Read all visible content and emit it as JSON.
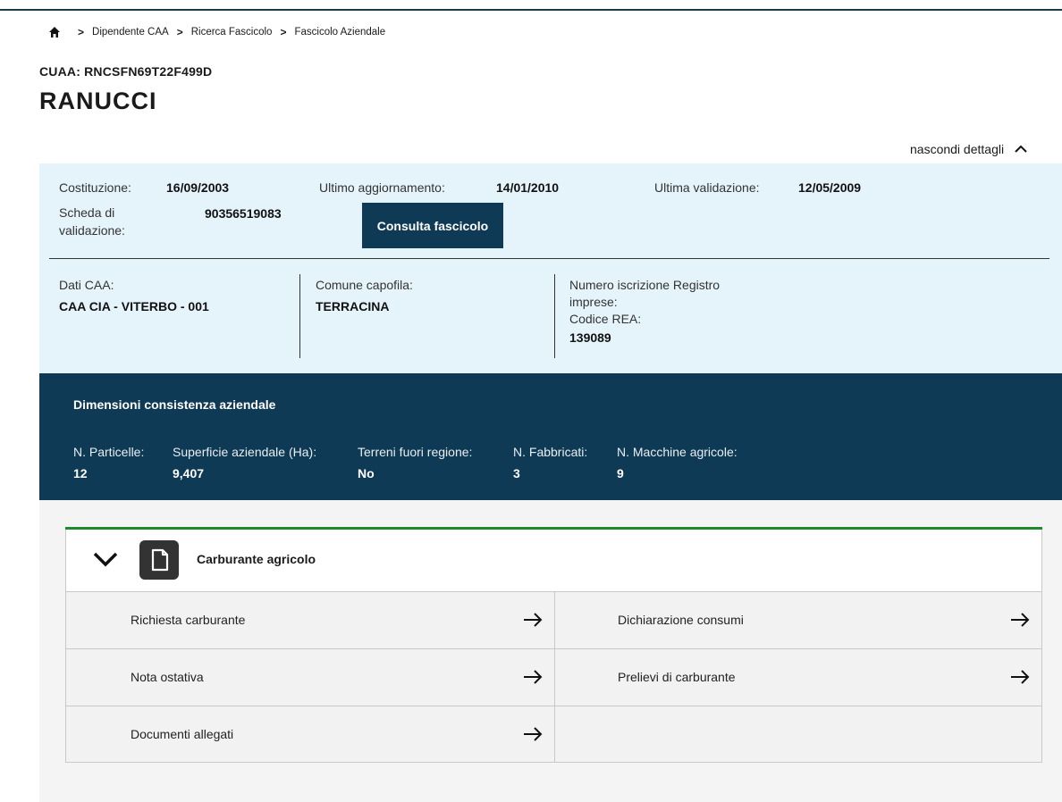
{
  "breadcrumb": {
    "items": [
      "Dipendente CAA",
      "Ricerca Fascicolo",
      "Fascicolo Aziendale"
    ],
    "separator": ">"
  },
  "header": {
    "cuaa_label": "CUAA:",
    "cuaa_value": "RNCSFN69T22F499D",
    "company_name": "RANUCCI"
  },
  "details_toggle": {
    "label": "nascondi dettagli"
  },
  "info": {
    "costituzione_label": "Costituzione:",
    "costituzione_value": "16/09/2003",
    "aggiornamento_label": "Ultimo aggiornamento:",
    "aggiornamento_value": "14/01/2010",
    "validazione_label": "Ultima validazione:",
    "validazione_value": "12/05/2009",
    "scheda_label_1": "Scheda di",
    "scheda_label_2": "validazione:",
    "scheda_value": "90356519083",
    "consulta_button": "Consulta fascicolo",
    "dati_caa_label": "Dati CAA:",
    "dati_caa_value": "CAA CIA - VITERBO - 001",
    "comune_label": "Comune capofila:",
    "comune_value": "TERRACINA",
    "registro_label_1": "Numero iscrizione Registro",
    "registro_label_2": "imprese:",
    "rea_label": "Codice REA:",
    "rea_value": "139089"
  },
  "dimensions": {
    "title": "Dimensioni consistenza aziendale",
    "stats": [
      {
        "label": "N. Particelle:",
        "value": "12"
      },
      {
        "label": "Superficie aziendale (Ha):",
        "value": "9,407"
      },
      {
        "label": "Terreni fuori regione:",
        "value": "No"
      },
      {
        "label": "N. Fabbricati:",
        "value": "3"
      },
      {
        "label": "N. Macchine agricole:",
        "value": "9"
      }
    ]
  },
  "card": {
    "title": "Carburante agricolo",
    "icon": "document-icon",
    "items": [
      "Richiesta carburante",
      "Dichiarazione consumi",
      "Nota ostativa",
      "Prelievi di carburante",
      "Documenti allegati"
    ]
  },
  "colors": {
    "navy": "#0f3a55",
    "light_blue": "#e5f4fb",
    "green_accent": "#1d8a2e",
    "cell_bg": "#f2f2f2"
  }
}
